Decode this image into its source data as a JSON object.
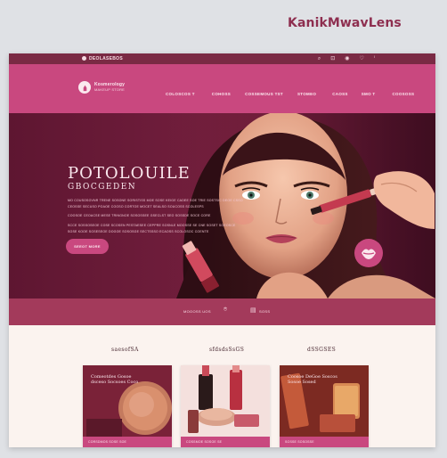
{
  "watermark": "KanikMwavLens",
  "topbar": {
    "brand": "DEOLASEBOS",
    "icons": [
      "search-icon",
      "cart-icon",
      "user-icon",
      "heart-icon",
      "info-icon"
    ]
  },
  "nav": {
    "logo_line1": "Kosmerology",
    "logo_line2": "MAKEUP STORE",
    "menu": [
      "COLOSCOS T",
      "COHOSS",
      "COSSEMOUS TST",
      "STOMEO",
      "CAOSS",
      "SMO T",
      "COOSOSS"
    ]
  },
  "hero": {
    "title": "POTOLOUILE",
    "subtitle": "GBOCGEDEN",
    "lines": [
      "MO COUSOSOVNR TRENE SOSONE SORISTISS MOE SOSE KEIGE CADEE SOE TRIE SOSTSIC DEOE CSSO",
      "CEOSSE SECUSO POAOE COOSO CORTOE MOCET SEALSO SOUCOSS SCOLESPS",
      "COOSOE CEOACSE MESE TRINGNOE SOSOSSEE GSECLST SEO SOSSDE SOCE CORE",
      "SCCE SOSSOSEOE COSE SCOSEN PESTAESEE CEPPRE SOSNLE MOOSSE SE CNE SOSET SOEOSCE",
      "SOSE KOOE SOSESEOE DOGOE SOSOSGE SECTSSSO ECAOSS SCOLOSOC COENTE"
    ],
    "cta": "SEEOT MORE"
  },
  "band": {
    "left": "MOOOSS   UOS",
    "right": "SOSS"
  },
  "products": [
    {
      "title": "saesofSA",
      "label": "Comeotdes Gosoe dsceso Socsoes Coco",
      "foot": "CORSDMOS SOSE SOE"
    },
    {
      "title": "sfdsdsSsGS",
      "label": "",
      "foot": "COSSMOE SOSOE SE"
    },
    {
      "title": "dSSGSES",
      "label": "Coosoe DeGoe Soscos Sosoe Sosed",
      "foot": "SOSSE SOSOSSE"
    }
  ],
  "colors": {
    "brand_pink": "#c9487f",
    "wine": "#7a2a44",
    "hero_dark": "#5e1631",
    "band": "#a33a5b",
    "cream": "#fbf3ef"
  }
}
